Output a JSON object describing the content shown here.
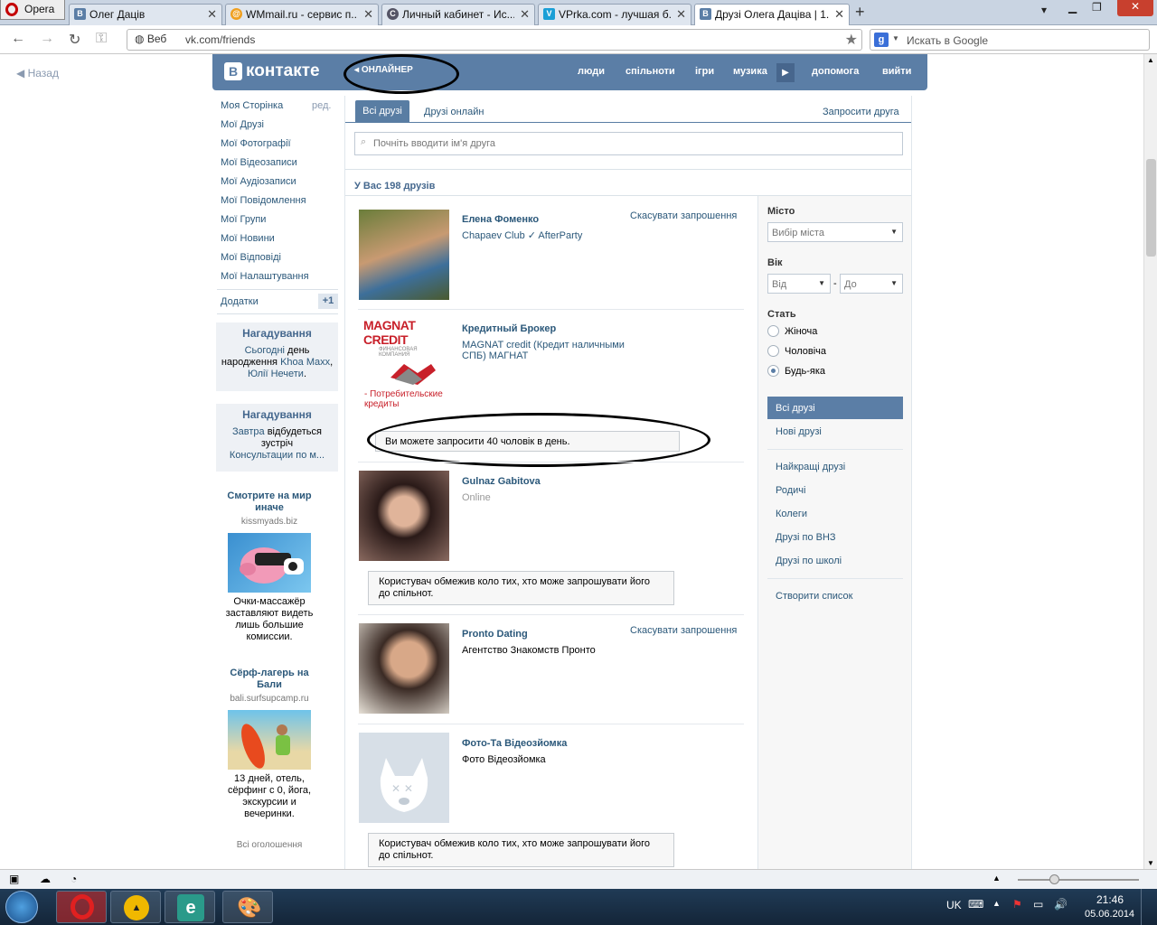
{
  "browser": {
    "menu_label": "Opera",
    "tabs": [
      {
        "title": "Олег Дацiв",
        "icon": "vk-icon"
      },
      {
        "title": "WMmail.ru - сервис п...",
        "icon": "wmmail-icon"
      },
      {
        "title": "Личный кабинет - Ис...",
        "icon": "globe-icon"
      },
      {
        "title": "VPrka.com - лучшая б...",
        "icon": "vprka-icon"
      },
      {
        "title": "Друзi Олега Дацiва | 1...",
        "icon": "vk-icon"
      }
    ],
    "address": {
      "prefix": "Веб",
      "url": "vk.com/friends"
    },
    "search_placeholder": "Искать в Google",
    "back_label": "Назад"
  },
  "vk": {
    "logo_text": "контакте",
    "player_label": "ОНЛАЙНЕР",
    "nav": [
      "люди",
      "спільноти",
      "ігри",
      "музика",
      "допомога",
      "вийти"
    ],
    "left_menu": {
      "items": [
        "Моя Сторінка",
        "Мої Друзі",
        "Мої Фотографії",
        "Мої Відеозаписи",
        "Мої Аудіозаписи",
        "Мої Повідомлення",
        "Мої Групи",
        "Мої Новини",
        "Мої Відповіді",
        "Мої Налаштування"
      ],
      "edit_label": "ред.",
      "apps_label": "Додатки",
      "apps_badge": "+1"
    },
    "reminders": [
      {
        "title": "Нагадування",
        "link1": "Сьогодні",
        "text1": " день народження ",
        "link2": "Khoa Maxx",
        "text2": ", ",
        "link3": "Юлії Нечети",
        "text3": "."
      },
      {
        "title": "Нагадування",
        "link1": "Завтра",
        "text1": " відбудеться зустріч",
        "link2": "Консультации по м..."
      }
    ],
    "ads": [
      {
        "title": "Смотрите на мир иначе",
        "domain": "kissmyads.biz",
        "body": "Очки-массажёр заставляют видеть лишь большие комиссии."
      },
      {
        "title": "Сёрф-лагерь на Бали",
        "domain": "bali.surfsupcamp.ru",
        "body": "13 дней, отель, сёрфинг с 0, йога, экскурсии и вечеринки."
      }
    ],
    "all_ads_label": "Всі оголошення",
    "tabs": {
      "all": "Всі друзі",
      "online": "Друзі онлайн",
      "invite": "Запросити друга"
    },
    "search_placeholder": "Почніть вводити ім'я друга",
    "count_label": "У Вас 198 друзів",
    "friends": [
      {
        "name": "Елена Фоменко",
        "sub": "Chapaev Club ✓ AfterParty",
        "cancel": "Скасувати запрошення"
      },
      {
        "name": "Кредитный Брокер",
        "sub": "MAGNAT credit (Кредит наличными СПБ) МАГНАТ",
        "logo_title": "MAGNAT CREDIT",
        "logo_sub": "ФИНАНСОВАЯ КОМПАНИЯ",
        "logo_caption": "- Потребительские кредиты"
      },
      {
        "name": "Gulnaz Gabitova",
        "status": "Online"
      },
      {
        "name": "Pronto Dating",
        "sub": "Агентство Знакомств Пронто",
        "cancel": "Скасувати запрошення"
      },
      {
        "name": "Фото-Та Відеозйомка",
        "sub": "Фото Відеозйомка"
      }
    ],
    "invite_limit": "Ви можете запросити 40 чоловік в день.",
    "restricted_notice": "Користувач обмежив коло тих, хто може запрошувати його до спільнот.",
    "filter": {
      "city_label": "Місто",
      "city_placeholder": "Вибір міста",
      "age_label": "Вік",
      "age_from": "Від",
      "age_to": "До",
      "age_dash": "-",
      "gender_label": "Стать",
      "genders": [
        "Жіноча",
        "Чоловіча",
        "Будь-яка"
      ],
      "gender_selected": "Будь-яка",
      "lists": [
        "Всі друзі",
        "Нові друзі",
        "Найкращі друзі",
        "Родичі",
        "Колеги",
        "Друзі по ВНЗ",
        "Друзі по школі",
        "Створити список"
      ]
    }
  },
  "system": {
    "lang": "UK",
    "time": "21:46",
    "date": "05.06.2014"
  },
  "colors": {
    "vk_blue": "#5b7ea6",
    "link": "#2b587a"
  }
}
